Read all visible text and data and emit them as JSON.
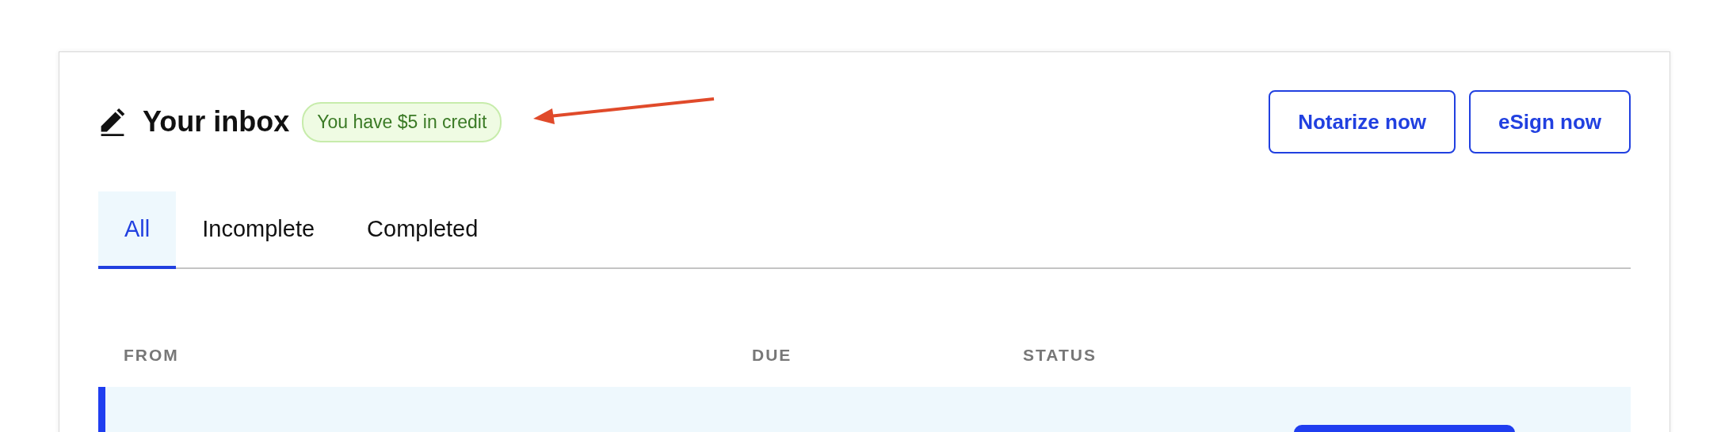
{
  "header": {
    "title": "Your inbox",
    "credit_badge": "You have $5 in credit"
  },
  "buttons": [
    {
      "label": "Notarize now"
    },
    {
      "label": "eSign now"
    }
  ],
  "tabs": [
    {
      "label": "All",
      "selected": true
    },
    {
      "label": "Incomplete",
      "selected": false
    },
    {
      "label": "Completed",
      "selected": false
    }
  ],
  "table": {
    "columns": [
      "FROM",
      "DUE",
      "STATUS"
    ],
    "rows": [
      {
        "selected": true
      }
    ]
  }
}
